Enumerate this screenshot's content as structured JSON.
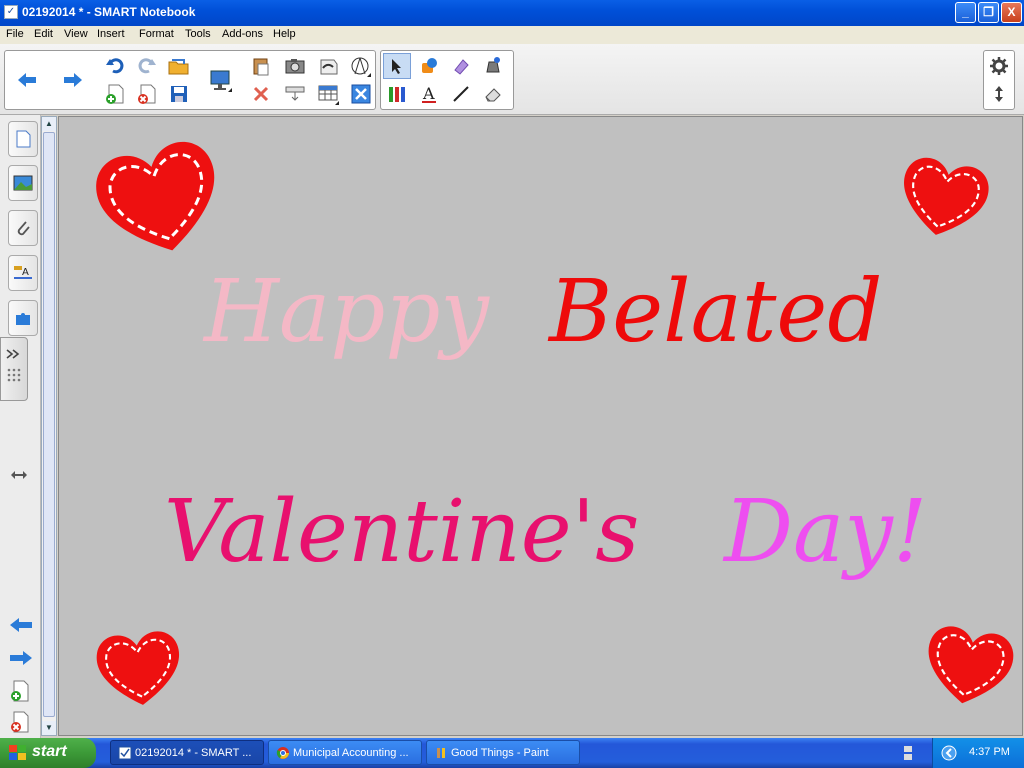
{
  "window": {
    "title": "02192014 * - SMART Notebook",
    "minimize_label": "_",
    "restore_label": "❐",
    "close_label": "X"
  },
  "menu": [
    "File",
    "Edit",
    "View",
    "Insert",
    "Format",
    "Tools",
    "Add-ons",
    "Help"
  ],
  "toolbar": {
    "buttons": [
      "back",
      "forward",
      "undo",
      "redo",
      "open",
      "new-page",
      "delete-page",
      "save",
      "screen-display",
      "paste",
      "screen-capture",
      "screen-shade",
      "full-screen",
      "add-table",
      "delete",
      "show-hide",
      "table",
      "clear",
      "select",
      "shapes",
      "eraser-pen",
      "fill",
      "creative-pens",
      "text",
      "line",
      "eraser",
      "settings",
      "move-toolbar"
    ]
  },
  "sidebar": {
    "tabs": [
      "page-sorter",
      "gallery",
      "attachments",
      "properties",
      "add-ons"
    ],
    "nav": [
      "previous-page",
      "next-page",
      "add-page",
      "delete-page"
    ]
  },
  "canvas": {
    "background": "#c0c0c0",
    "words": [
      {
        "text": "Happy",
        "color": "#f4b8c6"
      },
      {
        "text": "Belated",
        "color": "#ee0a0a"
      },
      {
        "text": "Valentine's",
        "color": "#e8106e"
      },
      {
        "text": "Day!",
        "color": "#ee4ef0"
      }
    ],
    "heart_color": "#ee1010"
  },
  "taskbar": {
    "start_label": "start",
    "tasks": [
      {
        "label": "02192014 * - SMART ..."
      },
      {
        "label": "Municipal Accounting ..."
      },
      {
        "label": "Good Things - Paint"
      }
    ],
    "clock": "4:37 PM"
  }
}
